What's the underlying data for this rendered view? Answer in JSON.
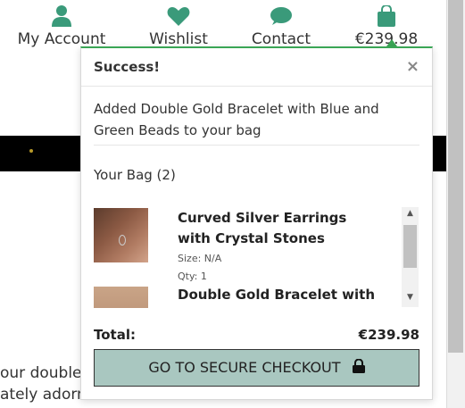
{
  "nav": {
    "account_label": "My Account",
    "wishlist_label": "Wishlist",
    "contact_label": "Contact",
    "bag_total": "€239.98",
    "icon_color": "#3a9a7a"
  },
  "background": {
    "text_line1": "our double",
    "text_line2": "ately adorned with"
  },
  "toast": {
    "title": "Success!",
    "close": "×",
    "message": "Added Double Gold Bracelet with Blue and Green Beads to your bag",
    "bag_heading": "Your Bag (2)",
    "items": [
      {
        "name": "Curved Silver Earrings with Crystal Stones",
        "size": "Size: N/A",
        "qty": "Qty: 1"
      },
      {
        "name": "Double Gold Bracelet with Blue"
      }
    ],
    "total_label": "Total:",
    "total_value": "€239.98",
    "checkout_label": "GO TO SECURE CHECKOUT",
    "accent_color": "#3aa655",
    "button_color": "#a9c7c0"
  }
}
